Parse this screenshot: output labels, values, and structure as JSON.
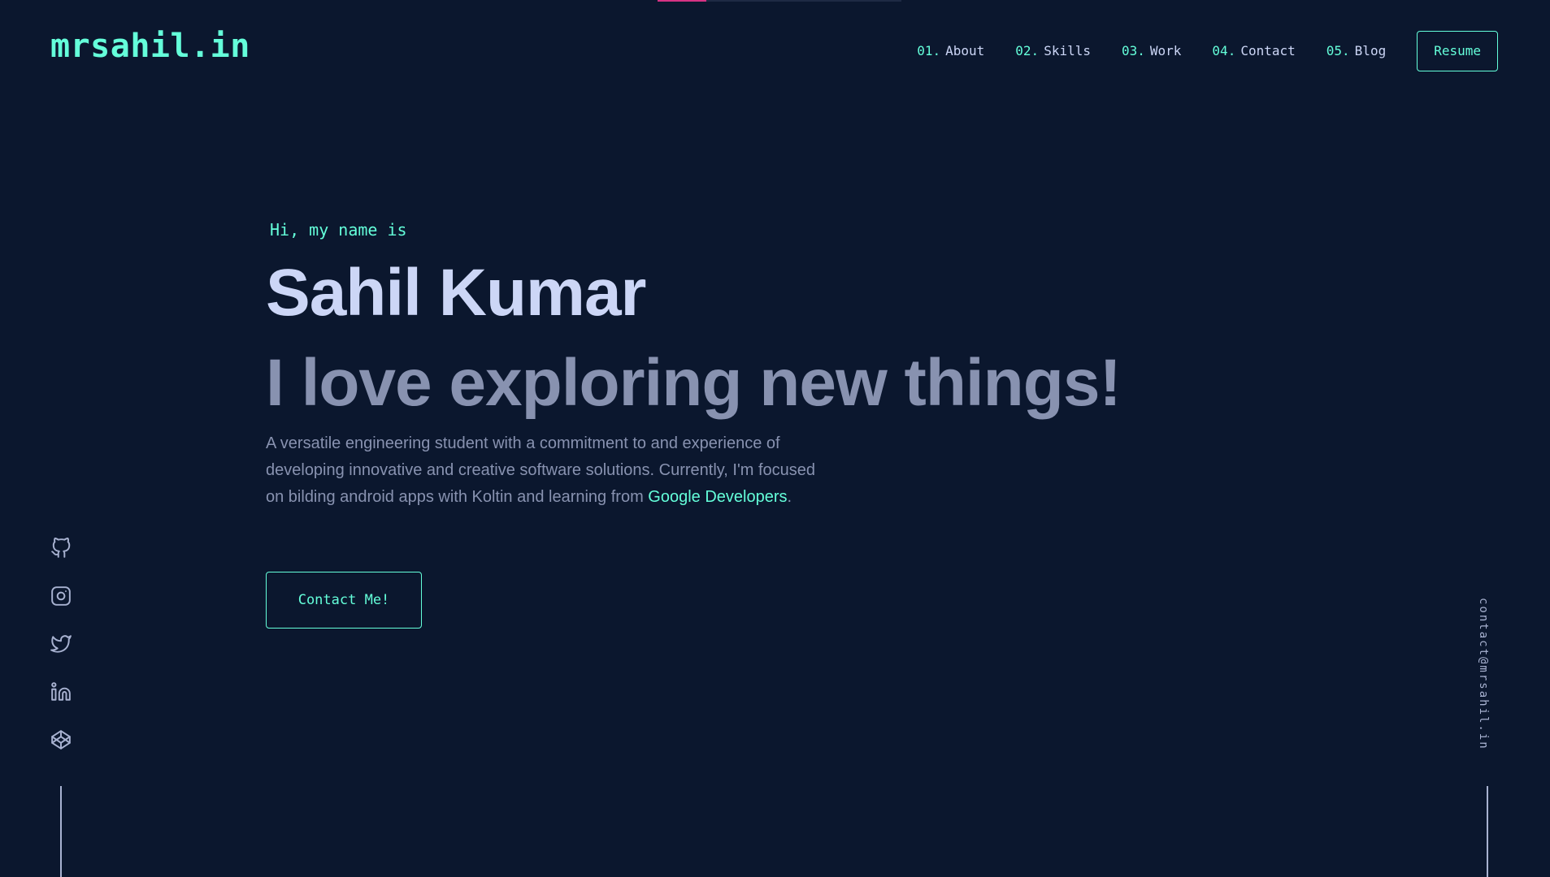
{
  "site": {
    "logo": "mrsahil.in",
    "scroll_progress": 0.2
  },
  "nav": {
    "items": [
      {
        "num": "01.",
        "label": "About"
      },
      {
        "num": "02.",
        "label": "Skills"
      },
      {
        "num": "03.",
        "label": "Work"
      },
      {
        "num": "04.",
        "label": "Contact"
      },
      {
        "num": "05.",
        "label": "Blog"
      }
    ],
    "resume_label": "Resume"
  },
  "hero": {
    "greeting": "Hi, my name is",
    "name": "Sahil Kumar",
    "tagline": "I love exploring new things!",
    "bio_text": "A versatile engineering student with a commitment to and experience of developing innovative and creative software solutions. Currently, I'm focused on bilding android apps with Koltin and learning from ",
    "bio_link": "Google Developers",
    "bio_end": ".",
    "contact_button": "Contact Me!"
  },
  "social": {
    "icons": [
      "github-icon",
      "instagram-icon",
      "twitter-icon",
      "linkedin-icon",
      "codepen-icon"
    ]
  },
  "email": "contact@mrsahil.in",
  "colors": {
    "background": "#0b172e",
    "accent": "#64ffda",
    "heading": "#ccd6f6",
    "muted": "#8892b0",
    "progress": "#d63384"
  }
}
